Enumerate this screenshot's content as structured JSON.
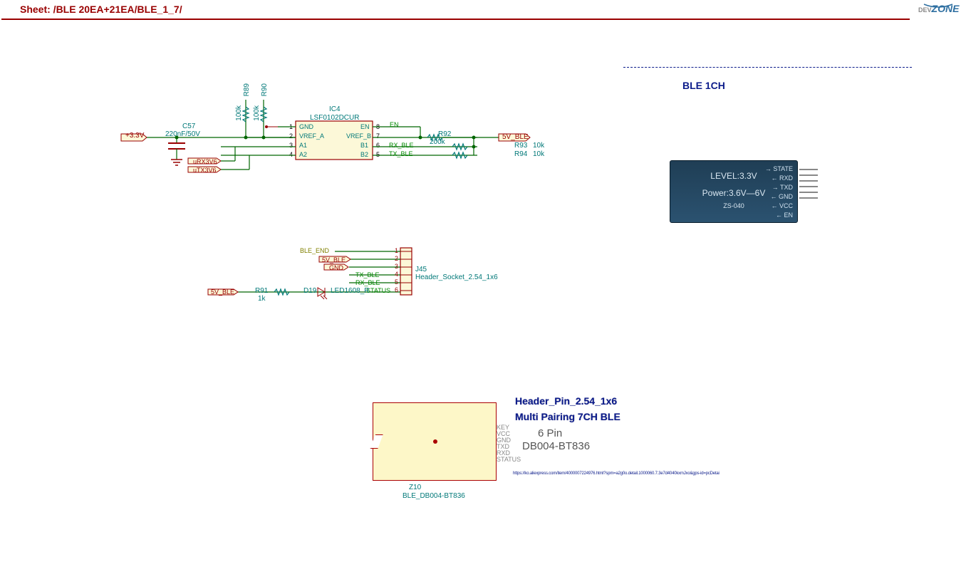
{
  "sheet": {
    "title": "Sheet: /BLE 20EA+21EA/BLE_1_7/"
  },
  "badge": {
    "brand_small": "DEV",
    "brand": "ZONE"
  },
  "power_rail": {
    "value": "+3.3V"
  },
  "cap": {
    "ref": "C57",
    "value": "220nF/50V"
  },
  "res": {
    "r89": {
      "ref": "R89",
      "value": "100k"
    },
    "r90": {
      "ref": "R90",
      "value": "100k"
    },
    "r91": {
      "ref": "R91",
      "value": "1k"
    },
    "r92": {
      "ref": "R92",
      "value": "200k"
    },
    "r93": {
      "ref": "R93",
      "value": "10k"
    },
    "r94": {
      "ref": "R94",
      "value": "10k"
    }
  },
  "ic": {
    "ref": "IC4",
    "part": "LSF0102DCUR",
    "pins": {
      "1": "GND",
      "2": "VREF_A",
      "3": "A1",
      "4": "A2",
      "8": "EN",
      "7": "VREF_B",
      "6": "B1",
      "5": "B2"
    }
  },
  "nets": {
    "en": "EN",
    "rx_ble": "RX_BLE",
    "tx_ble": "TX_BLE",
    "five_v_ble": "5V_BLE",
    "urx": "uRX3V6",
    "utx": "uTX3V6",
    "ble_end": "BLE_END",
    "gnd": "GND",
    "status": "STATUS"
  },
  "header": {
    "ref": "J45",
    "part": "Header_Socket_2.54_1x6",
    "pins": [
      "1",
      "2",
      "3",
      "4",
      "5",
      "6"
    ]
  },
  "led": {
    "ref": "D19",
    "part": "LED1608_R"
  },
  "ble_module": {
    "title": "BLE 1CH",
    "labels": {
      "state": "STATE",
      "rxd": "RXD",
      "txd": "TXD",
      "gnd": "GND",
      "vcc": "VCC",
      "en": "EN",
      "level": "LEVEL:3.3V",
      "power": "Power:3.6V—6V",
      "board": "ZS-040"
    }
  },
  "multi_pair": {
    "header": "Header_Pin_2.54_1x6",
    "title": "Multi Pairing 7CH BLE",
    "pins_txt": "6 Pin",
    "part": "DB004-BT836",
    "ref": "Z10",
    "footprint": "BLE_DB004-BT836",
    "pin_labels": [
      "KEY",
      "VCC",
      "GND",
      "TXD",
      "RXD",
      "STATUS"
    ],
    "url": "https://ko.aliexpress.com/item/4000007224976.html?spm=a2g0o.detail.1000060.7.3e7d4040kxmJxo&gps-id=pcDetai"
  }
}
